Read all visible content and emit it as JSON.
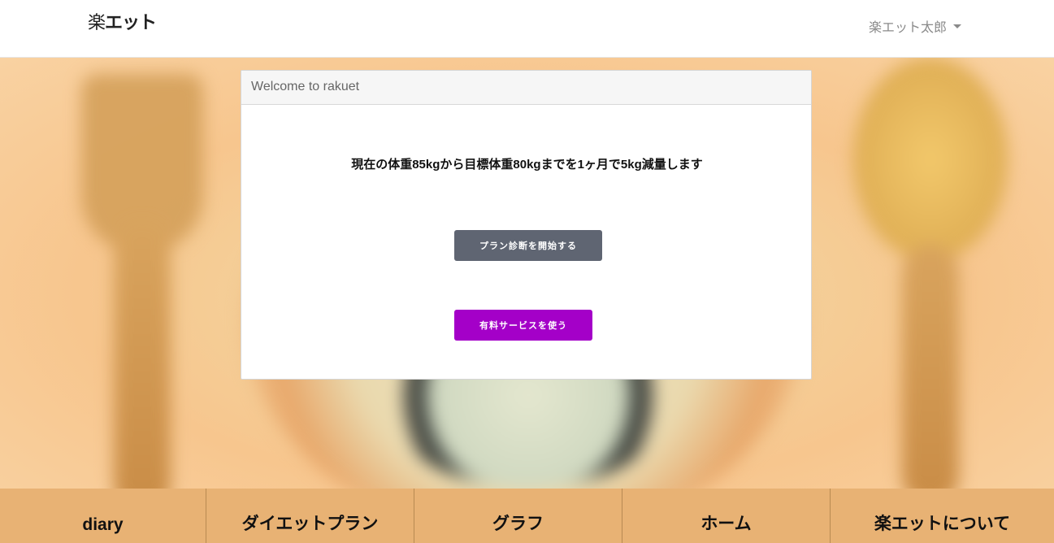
{
  "navbar": {
    "brand_prefix": "楽",
    "brand_suffix": "エット",
    "user_name": "楽エット太郎"
  },
  "card": {
    "header": "Welcome to rakuet",
    "goal_text": "現在の体重85kgから目標体重80kgまでを1ヶ月で5kg減量します",
    "plan_button": "プラン診断を開始する",
    "paid_button": "有料サービスを使う"
  },
  "bottom_nav": {
    "items": [
      "diary",
      "ダイエットプラン",
      "グラフ",
      "ホーム",
      "楽エットについて"
    ]
  },
  "colors": {
    "plan_button": "#5f6572",
    "paid_button": "#a400c8",
    "bottom_nav_bg": "#e8b274"
  }
}
